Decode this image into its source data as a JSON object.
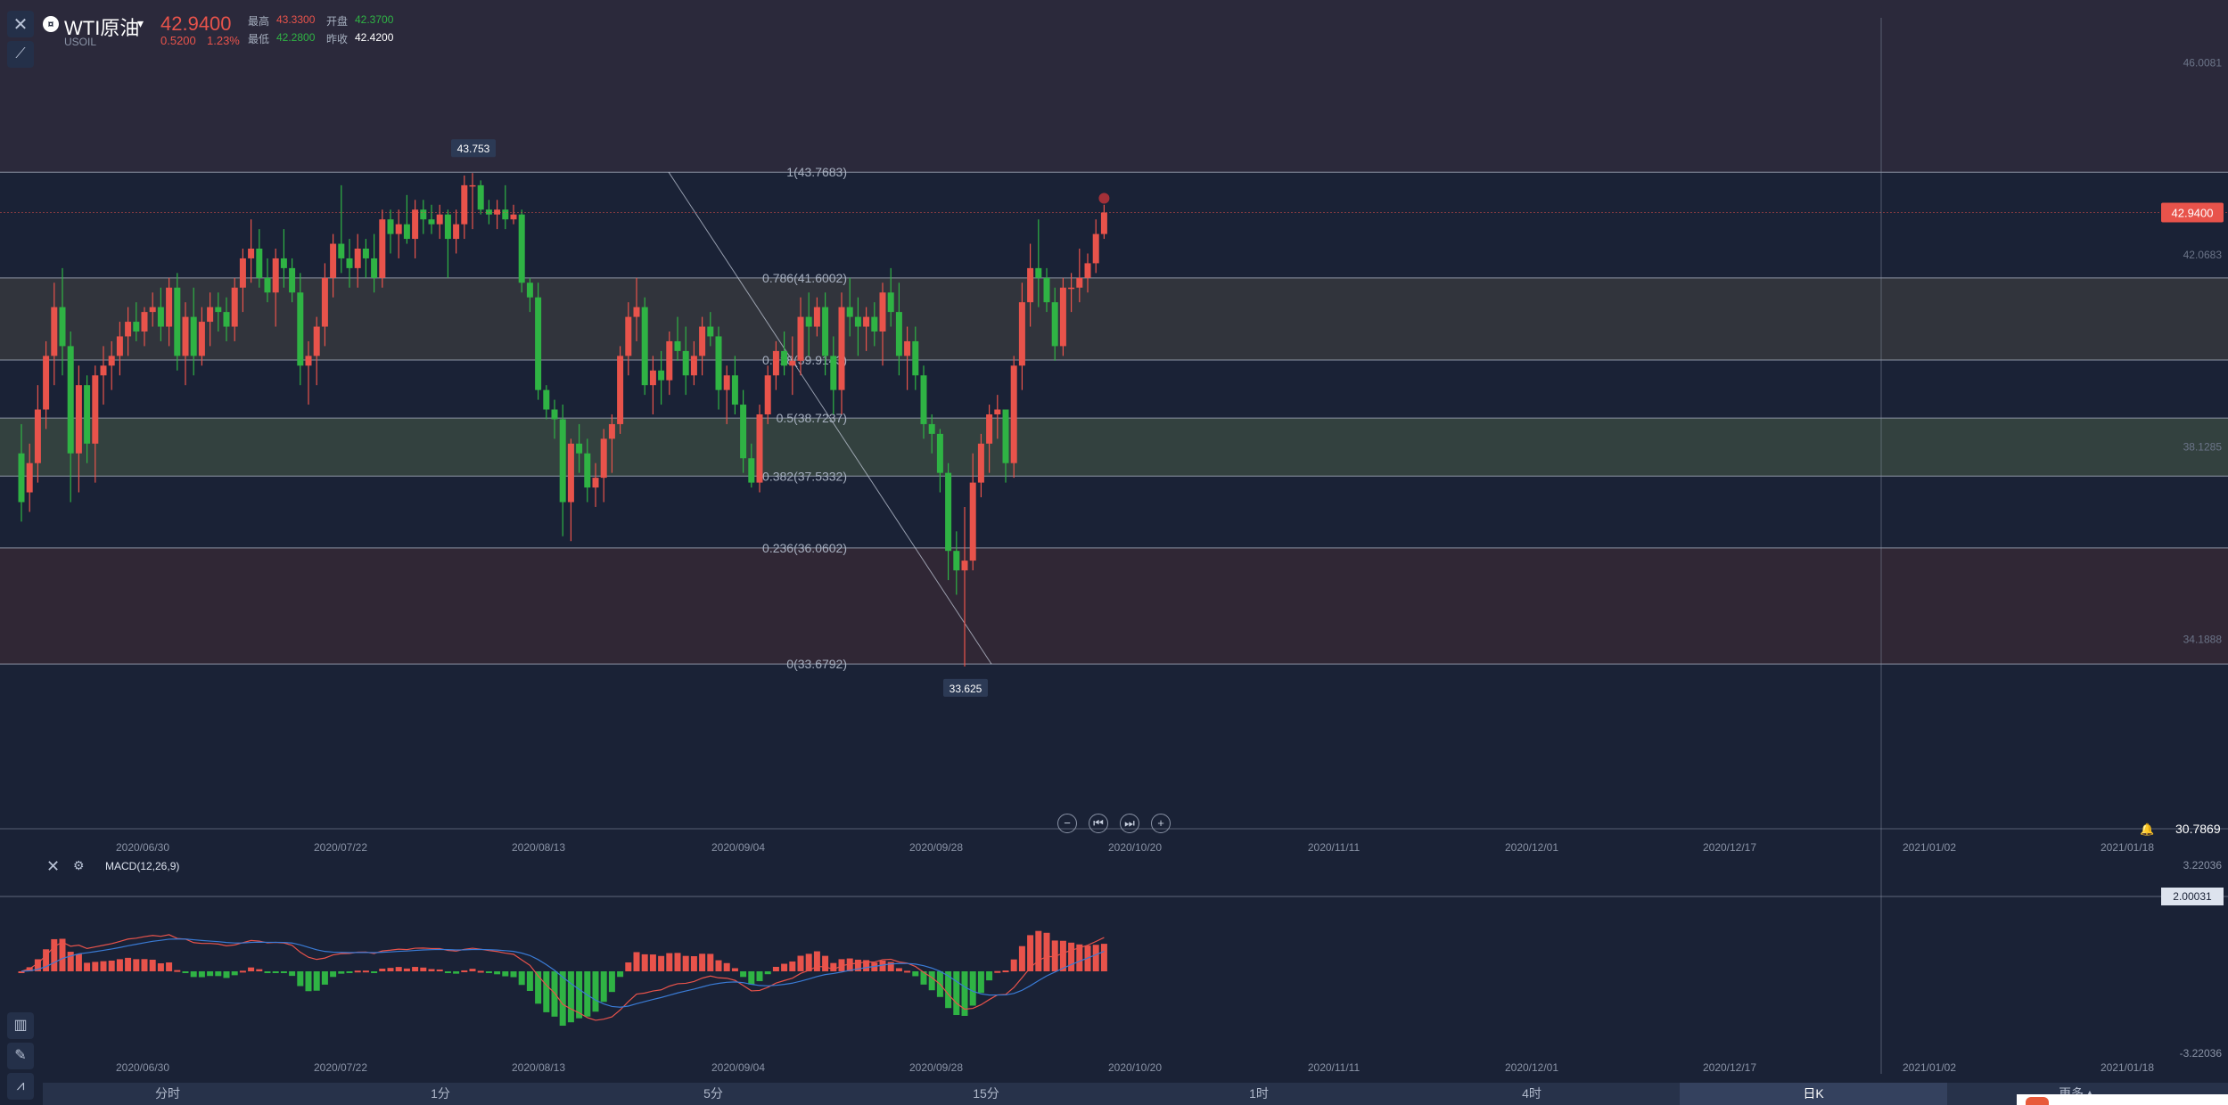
{
  "toolbar": {
    "close_icon": "close-icon",
    "draw_icon": "draw-line-icon"
  },
  "symbol": {
    "name": "WTI原油",
    "code": "USOIL",
    "icon": "symbol-logo-icon",
    "price": "42.9400",
    "change": "0.5200",
    "change_pct": "1.23%",
    "high_label": "最高",
    "high": "43.3300",
    "open_label": "开盘",
    "open": "42.3700",
    "low_label": "最低",
    "low": "42.2800",
    "prev_label": "昨收",
    "prev": "42.4200"
  },
  "colors": {
    "up": "#e8534b",
    "down": "#2fb344",
    "bg": "#1a2236",
    "fib_line": "#a8b0c0"
  },
  "price_axis": {
    "labels": [
      "46.0081",
      "42.0683",
      "38.1285",
      "34.1888"
    ],
    "current_price": "42.9400",
    "last_value": "30.7869"
  },
  "fib": {
    "levels": [
      {
        "label": "1(43.7683)",
        "value": 43.7683
      },
      {
        "label": "0.786(41.6002)",
        "value": 41.6002
      },
      {
        "label": "0.618(39.9143)",
        "value": 39.9143
      },
      {
        "label": "0.5(38.7237)",
        "value": 38.7237
      },
      {
        "label": "0.382(37.5332)",
        "value": 37.5332
      },
      {
        "label": "0.236(36.0602)",
        "value": 36.0602
      },
      {
        "label": "0(33.6792)",
        "value": 33.6792
      }
    ],
    "high_tag": "43.753",
    "low_tag": "33.625"
  },
  "x_axis": {
    "dates": [
      "2020/06/30",
      "2020/07/22",
      "2020/08/13",
      "2020/09/04",
      "2020/09/28",
      "2020/10/20",
      "2020/11/11",
      "2020/12/01",
      "2020/12/17",
      "2021/01/02",
      "2021/01/18"
    ]
  },
  "nav_controls": [
    "−",
    "⏮",
    "⏭",
    "+"
  ],
  "macd": {
    "label": "MACD(12,26,9)",
    "axis_labels": [
      "3.22036",
      "2.00031",
      "-3.22036"
    ]
  },
  "timeframes": [
    {
      "label": "分时",
      "active": false
    },
    {
      "label": "1分",
      "active": false
    },
    {
      "label": "5分",
      "active": false
    },
    {
      "label": "15分",
      "active": false
    },
    {
      "label": "1时",
      "active": false
    },
    {
      "label": "4时",
      "active": false
    },
    {
      "label": "日K",
      "active": true
    },
    {
      "label": "更多▲",
      "active": false
    }
  ],
  "chart_data": {
    "type": "candlestick",
    "title": "",
    "ylim": [
      30.3,
      47.3
    ],
    "y_ticks": [
      46.0081,
      42.0683,
      38.1285,
      34.1888
    ],
    "candles": [
      [
        38.0,
        38.6,
        36.6,
        37.0
      ],
      [
        37.2,
        38.2,
        36.8,
        37.8
      ],
      [
        37.8,
        39.4,
        37.4,
        38.9
      ],
      [
        38.9,
        40.3,
        38.5,
        40.0
      ],
      [
        40.0,
        41.5,
        39.4,
        41.0
      ],
      [
        41.0,
        41.8,
        39.6,
        40.2
      ],
      [
        40.2,
        40.5,
        37.0,
        38.0
      ],
      [
        38.0,
        39.8,
        37.2,
        39.4
      ],
      [
        39.4,
        39.6,
        37.8,
        38.2
      ],
      [
        38.2,
        39.8,
        37.4,
        39.6
      ],
      [
        39.6,
        40.2,
        39.0,
        39.8
      ],
      [
        39.8,
        40.3,
        39.3,
        40.0
      ],
      [
        40.0,
        40.7,
        39.6,
        40.4
      ],
      [
        40.4,
        41.0,
        40.0,
        40.7
      ],
      [
        40.7,
        41.1,
        40.3,
        40.5
      ],
      [
        40.5,
        41.0,
        40.2,
        40.9
      ],
      [
        40.9,
        41.3,
        40.6,
        41.0
      ],
      [
        41.0,
        41.4,
        40.3,
        40.6
      ],
      [
        40.6,
        41.6,
        40.2,
        41.4
      ],
      [
        41.4,
        41.7,
        39.7,
        40.0
      ],
      [
        40.0,
        41.1,
        39.4,
        40.8
      ],
      [
        40.8,
        41.4,
        39.6,
        40.0
      ],
      [
        40.0,
        41.0,
        39.8,
        40.7
      ],
      [
        40.7,
        41.3,
        40.2,
        41.0
      ],
      [
        41.0,
        41.3,
        40.5,
        40.9
      ],
      [
        40.9,
        41.2,
        40.3,
        40.6
      ],
      [
        40.6,
        41.6,
        40.3,
        41.4
      ],
      [
        41.4,
        42.2,
        40.9,
        42.0
      ],
      [
        42.0,
        42.8,
        41.5,
        42.2
      ],
      [
        42.2,
        42.6,
        41.4,
        41.6
      ],
      [
        41.6,
        42.0,
        41.1,
        41.3
      ],
      [
        41.3,
        42.2,
        40.6,
        42.0
      ],
      [
        42.0,
        42.6,
        41.4,
        41.8
      ],
      [
        41.8,
        42.0,
        41.1,
        41.3
      ],
      [
        41.3,
        41.7,
        39.4,
        39.8
      ],
      [
        39.8,
        40.3,
        39.0,
        40.0
      ],
      [
        40.0,
        40.8,
        39.4,
        40.6
      ],
      [
        40.6,
        41.9,
        40.2,
        41.6
      ],
      [
        41.6,
        42.5,
        41.2,
        42.3
      ],
      [
        42.3,
        43.5,
        41.7,
        42.0
      ],
      [
        42.0,
        42.4,
        41.4,
        41.8
      ],
      [
        41.8,
        42.5,
        41.4,
        42.2
      ],
      [
        42.2,
        42.4,
        41.6,
        42.0
      ],
      [
        42.0,
        42.5,
        41.3,
        41.6
      ],
      [
        41.6,
        43.0,
        41.4,
        42.8
      ],
      [
        42.8,
        43.0,
        42.1,
        42.5
      ],
      [
        42.5,
        43.0,
        42.0,
        42.7
      ],
      [
        42.7,
        43.3,
        42.3,
        42.4
      ],
      [
        42.4,
        43.2,
        42.0,
        43.0
      ],
      [
        43.0,
        43.2,
        42.5,
        42.8
      ],
      [
        42.8,
        43.1,
        42.5,
        42.7
      ],
      [
        42.7,
        43.1,
        42.4,
        42.9
      ],
      [
        42.9,
        43.0,
        41.6,
        42.4
      ],
      [
        42.4,
        43.0,
        42.1,
        42.7
      ],
      [
        42.7,
        43.7,
        42.4,
        43.5
      ],
      [
        43.5,
        43.75,
        42.6,
        43.5
      ],
      [
        43.5,
        43.6,
        42.9,
        43.0
      ],
      [
        43.0,
        43.2,
        42.7,
        42.9
      ],
      [
        42.9,
        43.2,
        42.6,
        43.0
      ],
      [
        43.0,
        43.5,
        42.6,
        42.8
      ],
      [
        42.8,
        43.1,
        42.7,
        42.9
      ],
      [
        42.9,
        43.0,
        41.3,
        41.5
      ],
      [
        41.5,
        41.6,
        40.9,
        41.2
      ],
      [
        41.2,
        41.5,
        39.1,
        39.3
      ],
      [
        39.3,
        39.4,
        38.7,
        38.9
      ],
      [
        38.9,
        39.1,
        38.3,
        38.7
      ],
      [
        38.7,
        39.0,
        36.3,
        37.0
      ],
      [
        37.0,
        38.3,
        36.2,
        38.2
      ],
      [
        38.2,
        38.6,
        37.6,
        38.0
      ],
      [
        38.0,
        38.3,
        37.0,
        37.3
      ],
      [
        37.3,
        37.8,
        36.9,
        37.5
      ],
      [
        37.5,
        38.5,
        37.0,
        38.3
      ],
      [
        38.3,
        38.8,
        37.6,
        38.6
      ],
      [
        38.6,
        40.2,
        38.4,
        40.0
      ],
      [
        40.0,
        41.1,
        39.6,
        40.8
      ],
      [
        40.8,
        41.6,
        40.3,
        41.0
      ],
      [
        41.0,
        41.2,
        39.2,
        39.4
      ],
      [
        39.4,
        40.0,
        38.8,
        39.7
      ],
      [
        39.7,
        40.1,
        39.0,
        39.5
      ],
      [
        39.5,
        40.5,
        39.2,
        40.3
      ],
      [
        40.3,
        40.8,
        39.9,
        40.1
      ],
      [
        40.1,
        40.6,
        39.2,
        39.6
      ],
      [
        39.6,
        40.3,
        39.4,
        40.0
      ],
      [
        40.0,
        40.8,
        39.6,
        40.6
      ],
      [
        40.6,
        40.9,
        40.2,
        40.4
      ],
      [
        40.4,
        40.6,
        38.9,
        39.3
      ],
      [
        39.3,
        39.8,
        38.6,
        39.6
      ],
      [
        39.6,
        40.0,
        38.8,
        39.0
      ],
      [
        39.0,
        39.3,
        37.6,
        37.9
      ],
      [
        37.9,
        38.2,
        37.3,
        37.4
      ],
      [
        37.4,
        39.0,
        37.2,
        38.8
      ],
      [
        38.8,
        39.8,
        38.6,
        39.6
      ],
      [
        39.6,
        40.3,
        39.3,
        40.1
      ],
      [
        40.1,
        40.5,
        39.6,
        39.8
      ],
      [
        39.8,
        40.4,
        39.2,
        39.9
      ],
      [
        39.9,
        41.2,
        39.6,
        40.8
      ],
      [
        40.8,
        41.3,
        40.0,
        40.6
      ],
      [
        40.6,
        41.2,
        40.4,
        41.0
      ],
      [
        41.0,
        41.3,
        39.6,
        40.0
      ],
      [
        40.0,
        40.4,
        38.8,
        39.3
      ],
      [
        39.3,
        41.3,
        38.8,
        41.0
      ],
      [
        41.0,
        41.6,
        40.4,
        40.8
      ],
      [
        40.8,
        41.2,
        40.0,
        40.6
      ],
      [
        40.6,
        41.0,
        40.1,
        40.8
      ],
      [
        40.8,
        41.1,
        40.2,
        40.5
      ],
      [
        40.5,
        41.5,
        39.8,
        41.3
      ],
      [
        41.3,
        41.8,
        40.6,
        40.9
      ],
      [
        40.9,
        41.5,
        39.6,
        40.0
      ],
      [
        40.0,
        40.6,
        39.3,
        40.3
      ],
      [
        40.3,
        40.6,
        39.3,
        39.6
      ],
      [
        39.6,
        39.8,
        38.3,
        38.6
      ],
      [
        38.6,
        38.8,
        38.0,
        38.4
      ],
      [
        38.4,
        38.5,
        37.2,
        37.6
      ],
      [
        37.6,
        37.8,
        35.4,
        36.0
      ],
      [
        36.0,
        36.4,
        35.1,
        35.6
      ],
      [
        35.6,
        36.9,
        33.63,
        35.8
      ],
      [
        35.8,
        38.0,
        35.6,
        37.4
      ],
      [
        37.4,
        38.4,
        37.1,
        38.2
      ],
      [
        38.2,
        39.0,
        37.6,
        38.8
      ],
      [
        38.8,
        39.2,
        38.3,
        38.9
      ],
      [
        38.9,
        38.6,
        37.4,
        37.8
      ],
      [
        37.8,
        40.0,
        37.5,
        39.8
      ],
      [
        39.8,
        41.5,
        39.3,
        41.1
      ],
      [
        41.1,
        42.3,
        40.6,
        41.8
      ],
      [
        41.8,
        42.8,
        41.0,
        41.6
      ],
      [
        41.6,
        41.8,
        40.9,
        41.1
      ],
      [
        41.1,
        41.4,
        39.9,
        40.2
      ],
      [
        40.2,
        41.6,
        40.0,
        41.4
      ],
      [
        41.4,
        41.7,
        40.9,
        41.4
      ],
      [
        41.4,
        42.2,
        41.1,
        41.6
      ],
      [
        41.6,
        42.1,
        41.3,
        41.9
      ],
      [
        41.9,
        42.8,
        41.7,
        42.5
      ],
      [
        42.5,
        43.1,
        42.4,
        42.94
      ]
    ]
  }
}
